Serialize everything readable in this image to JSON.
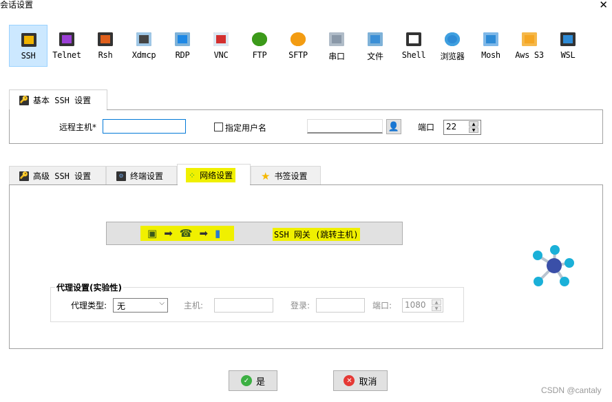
{
  "window": {
    "title": "会话设置",
    "close_icon": "close-icon"
  },
  "session_types": [
    {
      "label": "SSH",
      "icon": "key-icon",
      "color": "#f0b400",
      "bg": "#333333",
      "selected": true
    },
    {
      "label": "Telnet",
      "icon": "purple-gem-icon",
      "color": "#9b3fd6",
      "bg": "#333333"
    },
    {
      "label": "Rsh",
      "icon": "gears-icon",
      "color": "#e0601c",
      "bg": "#333333"
    },
    {
      "label": "Xdmcp",
      "icon": "x-monitor-icon",
      "color": "#444444",
      "bg": "#9fc7e6"
    },
    {
      "label": "RDP",
      "icon": "windows-monitor-icon",
      "color": "#1e88e5",
      "bg": "#7fb2d8"
    },
    {
      "label": "VNC",
      "icon": "vnc-monitor-icon",
      "color": "#d32f2f",
      "bg": "#dbe7f2"
    },
    {
      "label": "FTP",
      "icon": "green-globe-icon",
      "color": "#3c9a1a",
      "bg": "#3c9a1a"
    },
    {
      "label": "SFTP",
      "icon": "orange-globe-icon",
      "color": "#f39c12",
      "bg": "#f39c12"
    },
    {
      "label": "串口",
      "icon": "serial-plug-icon",
      "color": "#8a98a8",
      "bg": "#b0bcc8"
    },
    {
      "label": "文件",
      "icon": "file-monitor-icon",
      "color": "#3b8fd6",
      "bg": "#7fb2d8"
    },
    {
      "label": "Shell",
      "icon": "terminal-icon",
      "color": "#ffffff",
      "bg": "#333333"
    },
    {
      "label": "浏览器",
      "icon": "browser-globe-icon",
      "color": "#2e8bd6",
      "bg": "#3fa0e0"
    },
    {
      "label": "Mosh",
      "icon": "satellite-dish-icon",
      "color": "#2e8bd6",
      "bg": "#7fb8e8"
    },
    {
      "label": "Aws S3",
      "icon": "aws-boxes-icon",
      "color": "#f5a623",
      "bg": "#f5b84a"
    },
    {
      "label": "WSL",
      "icon": "windows-icon",
      "color": "#2e8bd6",
      "bg": "#333333"
    }
  ],
  "basic": {
    "tab_label": "基本 SSH 设置",
    "remote_host_label": "远程主机*",
    "remote_host_value": "",
    "specify_user_label": "指定用户名",
    "specify_user_checked": false,
    "username_value": "",
    "user_icon": "user-key-icon",
    "port_label": "端口",
    "port_value": "22"
  },
  "tabs": [
    {
      "label": "高级 SSH 设置",
      "icon": "key-icon",
      "active": false
    },
    {
      "label": "终端设置",
      "icon": "terminal-settings-icon",
      "active": false
    },
    {
      "label": "网络设置",
      "icon": "network-icon",
      "active": true
    },
    {
      "label": "书签设置",
      "icon": "star-icon",
      "active": false
    }
  ],
  "network": {
    "gateway_button_label": "SSH 网关 (跳转主机)",
    "proxy_group_label": "代理设置(实验性)",
    "proxy_type_label": "代理类型:",
    "proxy_type_value": "无",
    "host_label": "主机:",
    "host_value": "",
    "login_label": "登录:",
    "login_value": "",
    "port_label": "端口:",
    "port_value": "1080"
  },
  "footer": {
    "ok_label": "是",
    "cancel_label": "取消",
    "watermark": "CSDN @cantaly"
  },
  "colors": {
    "selected_bg": "#cce8ff",
    "highlight": "#f0f000",
    "ok": "#3cb043",
    "cancel": "#e53935"
  }
}
